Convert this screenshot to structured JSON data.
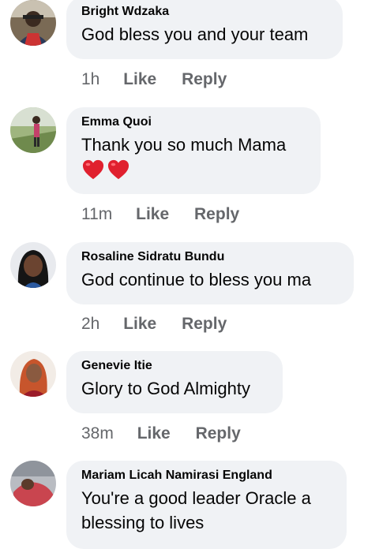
{
  "comments": [
    {
      "author": "Bright Wdzaka",
      "text": "God bless you and your team",
      "time": "1h",
      "like": "Like",
      "reply": "Reply"
    },
    {
      "author": "Emma Quoi",
      "text": "Thank you so much Mama",
      "hearts": [
        "red-heart-emoji",
        "red-heart-emoji"
      ],
      "time": "11m",
      "like": "Like",
      "reply": "Reply"
    },
    {
      "author": "Rosaline Sidratu Bundu",
      "text": "God continue to bless you ma",
      "time": "2h",
      "like": "Like",
      "reply": "Reply"
    },
    {
      "author": "Genevie Itie",
      "text": "Glory to God Almighty",
      "time": "38m",
      "like": "Like",
      "reply": "Reply"
    },
    {
      "author": "Mariam Licah Namirasi England",
      "text_line1": "You're a good leader Oracle a",
      "text_line2": "blessing to lives"
    }
  ],
  "colors": {
    "bubble": "#f0f2f5",
    "meta": "#65676b",
    "text": "#050505",
    "heart": "#e0202e"
  }
}
